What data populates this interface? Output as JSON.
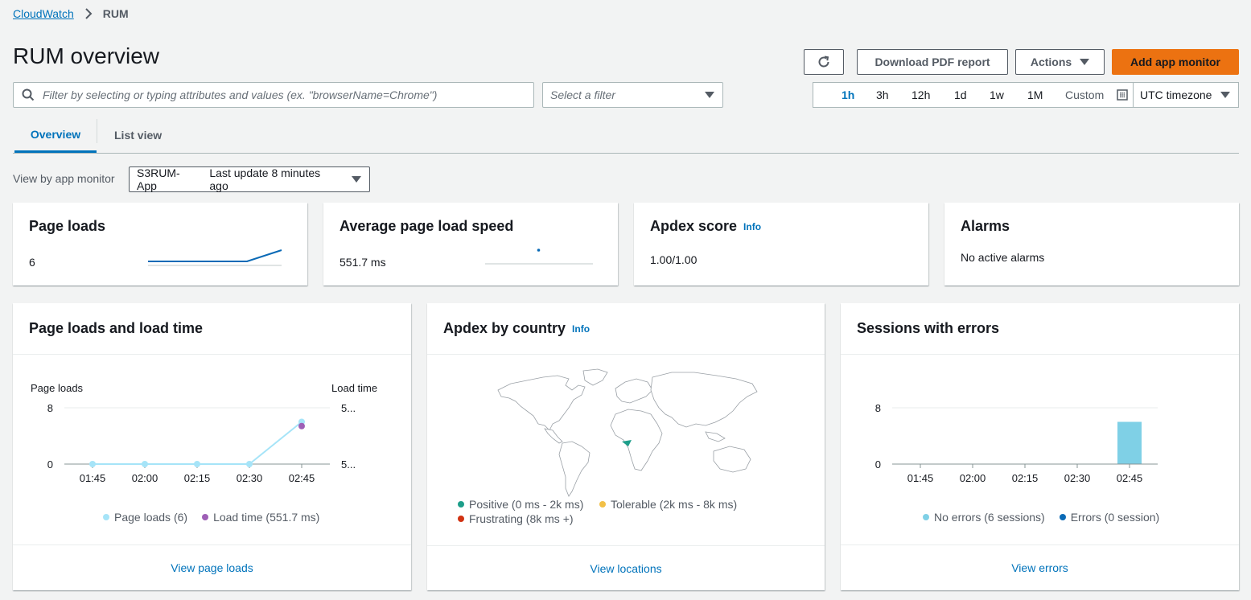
{
  "breadcrumb": {
    "root": "CloudWatch",
    "current": "RUM"
  },
  "page_title": "RUM overview",
  "toolbar": {
    "download_label": "Download PDF report",
    "actions_label": "Actions",
    "add_label": "Add app monitor"
  },
  "filter": {
    "placeholder": "Filter by selecting or typing attributes and values (ex. \"browserName=Chrome\")",
    "select_placeholder": "Select a filter"
  },
  "time_range": {
    "options": [
      "1h",
      "3h",
      "12h",
      "1d",
      "1w",
      "1M",
      "Custom"
    ],
    "selected": "1h",
    "timezone": "UTC timezone"
  },
  "tabs": [
    "Overview",
    "List view"
  ],
  "app_monitor": {
    "label": "View by app monitor",
    "name": "S3RUM-App",
    "update": "Last update 8 minutes ago"
  },
  "summary": {
    "page_loads_title": "Page loads",
    "page_loads_value": "6",
    "speed_title": "Average page load speed",
    "speed_value": "551.7 ms",
    "apdex_title": "Apdex score",
    "apdex_info": "Info",
    "apdex_value": "1.00/1.00",
    "alarms_title": "Alarms",
    "alarms_value": "No active alarms"
  },
  "panels": {
    "loads_title": "Page loads and load time",
    "loads_link": "View page loads",
    "apdex_title": "Apdex by country",
    "apdex_info": "Info",
    "apdex_link": "View locations",
    "apdex_legend": [
      "Positive (0 ms - 2k ms)",
      "Tolerable (2k ms - 8k ms)",
      "Frustrating (8k ms +)"
    ],
    "errors_title": "Sessions with errors",
    "errors_link": "View errors"
  },
  "colors": {
    "accent": "#0073bb",
    "primary_button": "#ec7211",
    "page_loads": "#a6e4f8",
    "load_time": "#9e5fb6",
    "no_errors": "#7fd0e6",
    "errors": "#0a6ab6",
    "positive": "#1d9e8a",
    "tolerable": "#f2c047",
    "frustrating": "#d13212"
  },
  "chart_data": [
    {
      "type": "line",
      "ylabel_left": "Page loads",
      "ylabel_right": "Load time",
      "x": [
        "01:45",
        "02:00",
        "02:15",
        "02:30",
        "02:45"
      ],
      "y_ticks_left": [
        0,
        8
      ],
      "y_ticks_right": [
        "5...",
        "5..."
      ],
      "ylim": [
        0,
        8
      ],
      "series": [
        {
          "name": "Page loads (6)",
          "values": [
            0,
            0,
            0,
            0,
            6
          ]
        },
        {
          "name": "Load time (551.7 ms)",
          "values": [
            null,
            null,
            null,
            null,
            5.4
          ]
        }
      ]
    },
    {
      "type": "bar",
      "x": [
        "01:45",
        "02:00",
        "02:15",
        "02:30",
        "02:45"
      ],
      "y_ticks": [
        0,
        8
      ],
      "ylim": [
        0,
        8
      ],
      "series": [
        {
          "name": "No errors (6 sessions)",
          "values": [
            0,
            0,
            0,
            0,
            6
          ]
        },
        {
          "name": "Errors (0 session)",
          "values": [
            0,
            0,
            0,
            0,
            0
          ]
        }
      ]
    }
  ]
}
